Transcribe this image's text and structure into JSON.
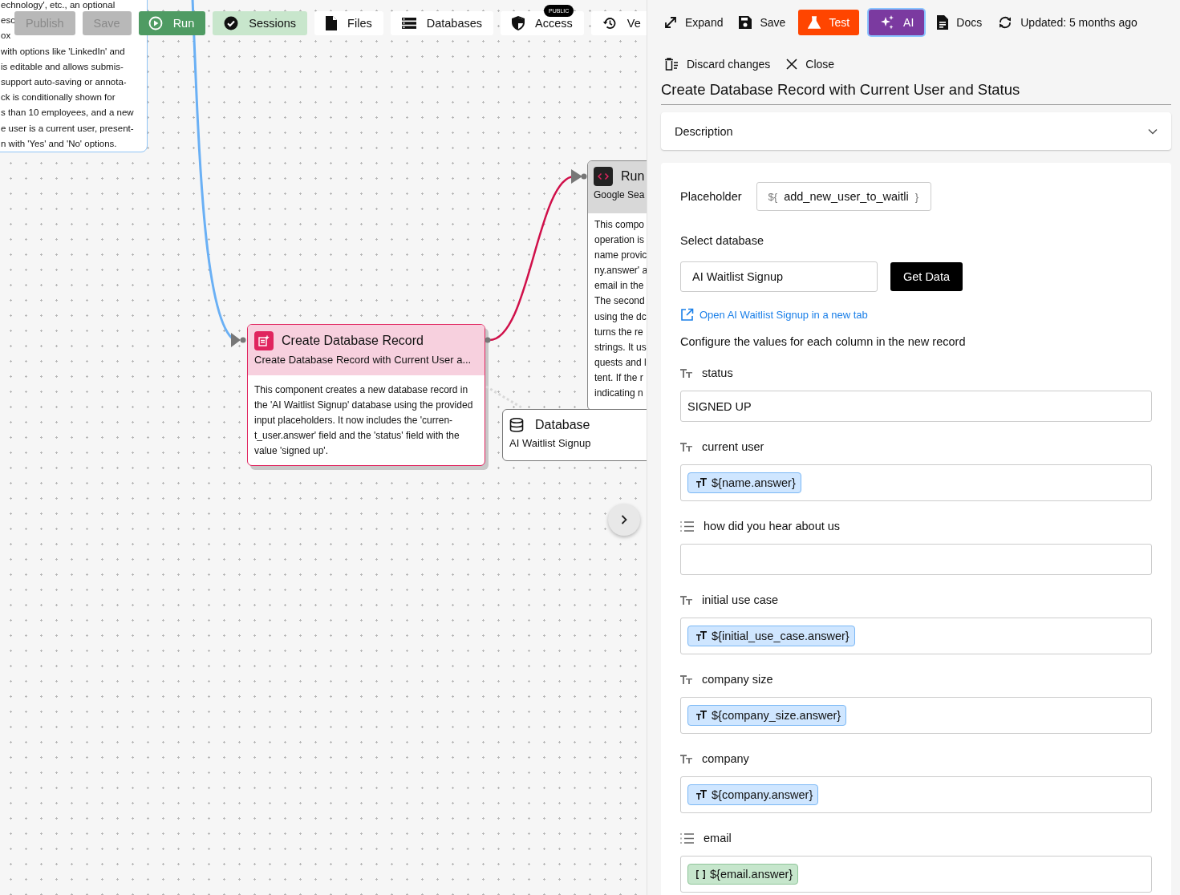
{
  "canvas_toolbar": [
    {
      "label": "Publish",
      "kind": "publish",
      "disabled": true
    },
    {
      "label": "Save",
      "kind": "save",
      "disabled": true
    },
    {
      "label": "Run",
      "kind": "run",
      "disabled": false
    },
    {
      "label": "Sessions",
      "kind": "sessions",
      "disabled": false
    },
    {
      "label": "Files",
      "kind": "files",
      "disabled": false
    },
    {
      "label": "Databases",
      "kind": "databases",
      "disabled": false
    },
    {
      "label": "Access",
      "kind": "access",
      "disabled": false,
      "badge": "PUBLIC"
    },
    {
      "label": "Ve",
      "kind": "versions",
      "disabled": false
    }
  ],
  "nodes": [
    {
      "kind": "form",
      "lines": [
        "echnology', etc., an optional",
        "esc",
        "ox",
        "with options like 'LinkedIn' and",
        "is editable and allows submis-",
        "support auto-saving or annota-",
        "ck is conditionally shown for",
        "s than 10 employees, and a new",
        "e user is a current user, present-",
        "n with 'Yes' and 'No' options."
      ]
    },
    {
      "kind": "code",
      "title": "Run",
      "subtitle": "Google Sea",
      "lines": [
        "This compo",
        "operation is",
        "name provic",
        "ny.answer' a",
        "email in the",
        "The second",
        "using the dc",
        "turns the re",
        "strings. It us",
        "quests and l",
        "tent. If the r",
        "indicating n"
      ]
    },
    {
      "kind": "create_record",
      "selected": true,
      "title": "Create Database Record",
      "subtitle": "Create Database Record with Current User a...",
      "lines": [
        "This component creates a new database record in",
        "the 'AI Waitlist Signup' database using the provided",
        "input placeholders. It now includes the 'curren-",
        "t_user.answer' field and the 'status' field with the",
        "value 'signed up'."
      ]
    },
    {
      "kind": "database",
      "title": "Database",
      "subtitle": "AI Waitlist Signup"
    }
  ],
  "panel": {
    "toolbar": [
      {
        "label": "Expand",
        "kind": "expand"
      },
      {
        "label": "Save",
        "kind": "save"
      },
      {
        "label": "Test",
        "kind": "test"
      },
      {
        "label": "AI",
        "kind": "ai"
      },
      {
        "label": "Docs",
        "kind": "docs"
      },
      {
        "label": "Updated: 5 months ago",
        "kind": "updated"
      },
      {
        "label": "Discard changes",
        "kind": "discard"
      },
      {
        "label": "Close",
        "kind": "close"
      }
    ],
    "title": "Create Database Record with Current User and Status",
    "description": {
      "label": "Description",
      "expanded": false
    },
    "placeholder": {
      "label": "Placeholder",
      "prefix": "${",
      "value": "add_new_user_to_waitli",
      "suffix": "}"
    },
    "database": {
      "label": "Select database",
      "value": "AI Waitlist Signup",
      "button": "Get Data",
      "link": "Open AI Waitlist Signup in a new tab"
    },
    "columns_heading": "Configure the values for each column in the new record",
    "columns": [
      {
        "name": "status",
        "kind": "text",
        "value": "SIGNED UP"
      },
      {
        "name": "current user",
        "kind": "text",
        "chips": [
          {
            "kind": "text",
            "label": "${name.answer}"
          }
        ]
      },
      {
        "name": "how did you hear about us",
        "kind": "list"
      },
      {
        "name": "initial use case",
        "kind": "text",
        "chips": [
          {
            "kind": "text",
            "label": "${initial_use_case.answer}"
          }
        ]
      },
      {
        "name": "company size",
        "kind": "text",
        "chips": [
          {
            "kind": "text",
            "label": "${company_size.answer}"
          }
        ]
      },
      {
        "name": "company",
        "kind": "text",
        "chips": [
          {
            "kind": "text",
            "label": "${company.answer}"
          }
        ]
      },
      {
        "name": "email",
        "kind": "list",
        "chips": [
          {
            "kind": "list",
            "label": "${email.answer}"
          }
        ]
      }
    ]
  }
}
